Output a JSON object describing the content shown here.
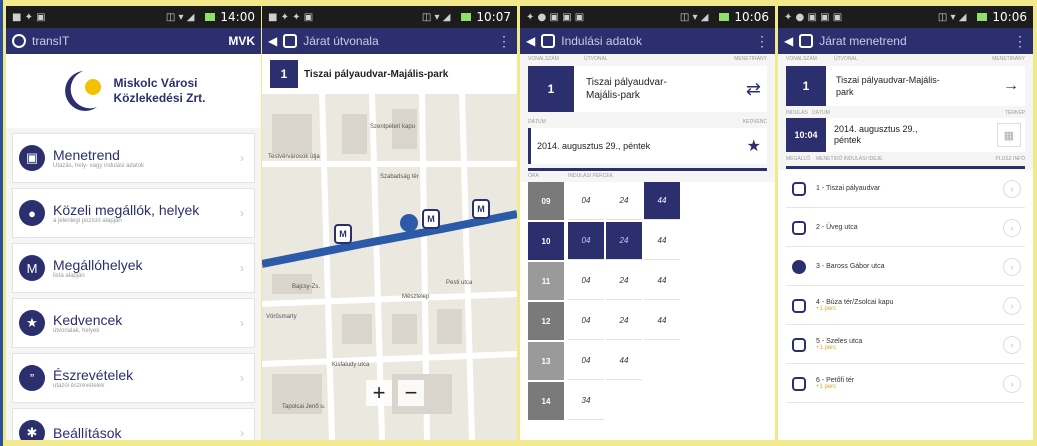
{
  "status_bars": [
    {
      "time": "14:00"
    },
    {
      "time": "10:07"
    },
    {
      "time": "10:06"
    },
    {
      "time": "10:06"
    }
  ],
  "screen1": {
    "app_title": "transIT",
    "brand": "MVK",
    "logo_line1": "Miskolc Városi",
    "logo_line2": "Közlekedési Zrt.",
    "menu": [
      {
        "label": "Menetrend",
        "sub": "Utazás, hely- vagy indulási adatok",
        "icon": "bus-icon"
      },
      {
        "label": "Közeli megállók, helyek",
        "sub": "a jelenlegi pozíció alapján",
        "icon": "location-pin-icon"
      },
      {
        "label": "Megállóhelyek",
        "sub": "lista alapján",
        "icon": "stop-marker-icon"
      },
      {
        "label": "Kedvencek",
        "sub": "útvonalak, helyek",
        "icon": "star-icon"
      },
      {
        "label": "Észrevételek",
        "sub": "utazói észrevételek",
        "icon": "quote-icon"
      },
      {
        "label": "Beállítások",
        "sub": "",
        "icon": "gear-icon"
      }
    ]
  },
  "screen2": {
    "title": "Járat útvonala",
    "route_number": "1",
    "route_name": "Tiszai pályaudvar-Majális-park",
    "map_labels": [
      "Szentpéteri kapu",
      "Testvérvárosok útja",
      "Szabadság tér",
      "Pesti utca",
      "Vörösmarty",
      "Bajcsy-Zs.",
      "Mésztelep",
      "Kisfaludy utca",
      "Tapolcai Jenő u."
    ],
    "zoom_in": "+",
    "zoom_out": "−"
  },
  "screen3": {
    "title": "Indulási adatok",
    "col_vonalszam": "VONALSZÁM",
    "col_utvonal": "ÚTVONAL",
    "col_menetirany": "MENETIRÁNY",
    "route_number": "1",
    "route_name_line1": "Tiszai pályaudvar-",
    "route_name_line2": "Majális-park",
    "col_datum": "DÁTUM",
    "col_kedvenc": "KEDVENC",
    "date": "2014. augusztus 29., péntek",
    "col_ora": "ÓRA",
    "col_percek": "INDULÁSI PERCEK",
    "rows": [
      {
        "hour": "09",
        "mins": [
          "04",
          "24",
          "44"
        ]
      },
      {
        "hour": "10",
        "mins": [
          "04",
          "24",
          "44"
        ]
      },
      {
        "hour": "11",
        "mins": [
          "04",
          "24",
          "44"
        ]
      },
      {
        "hour": "12",
        "mins": [
          "04",
          "24",
          "44"
        ]
      },
      {
        "hour": "13",
        "mins": [
          "04",
          "44",
          ""
        ]
      },
      {
        "hour": "14",
        "mins": [
          "34",
          "",
          ""
        ]
      }
    ]
  },
  "screen4": {
    "title": "Járat menetrend",
    "col_vonalszam": "VONALSZÁM",
    "col_utvonal": "ÚTVONAL",
    "col_menetirany": "MENETIRÁNY",
    "route_number": "1",
    "route_name_line1": "Tiszai pályaudvar-Majális-",
    "route_name_line2": "park",
    "col_indulas": "INDULÁS",
    "col_datum": "DÁTUM",
    "col_terkep": "TÉRKÉP",
    "depart_time": "10:04",
    "date_line1": "2014. augusztus 29.,",
    "date_line2": "péntek",
    "col_megallo": "MEGÁLLÓ",
    "col_menetido": "MENETIDŐ INDULÁSI IDEJE",
    "col_pluszinfo": "PLUSZ INFÓ",
    "stops": [
      {
        "name": "1 - Tiszai pályaudvar",
        "note": ""
      },
      {
        "name": "2 - Üveg utca",
        "note": ""
      },
      {
        "name": "3 - Baross Gábor utca",
        "note": ""
      },
      {
        "name": "4 - Búza tér/Zsolcai kapu",
        "note": "+1 perc"
      },
      {
        "name": "5 - Szeles utca",
        "note": "+1 perc"
      },
      {
        "name": "6 - Petőfi tér",
        "note": "+1 perc"
      }
    ]
  }
}
